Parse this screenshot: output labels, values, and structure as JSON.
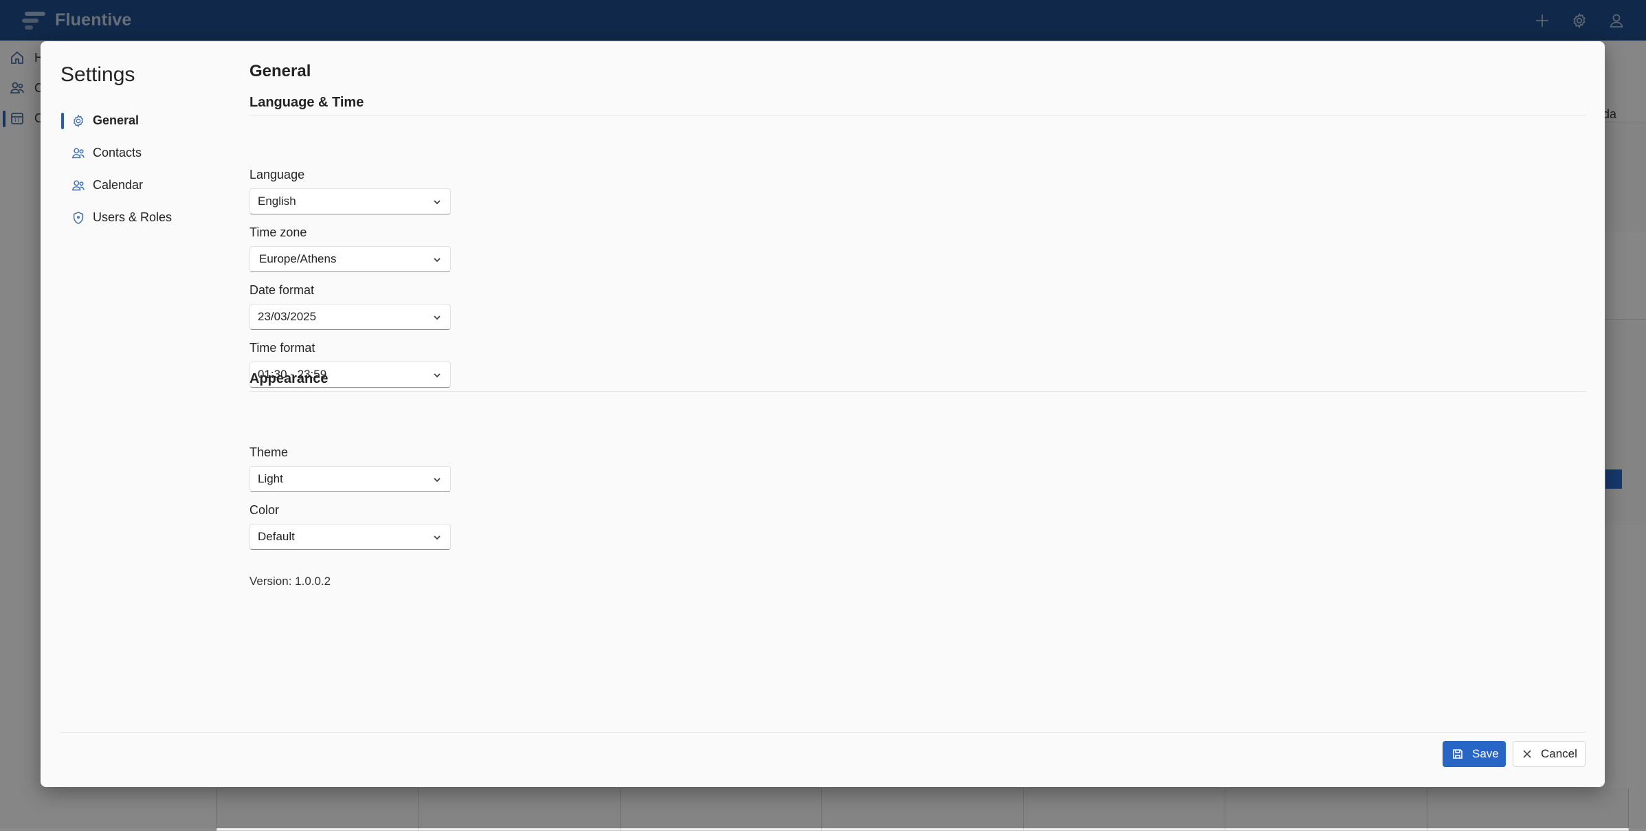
{
  "app": {
    "name": "Fluentive"
  },
  "topbar": {
    "icons": [
      "add-icon",
      "settings-icon",
      "user-icon"
    ]
  },
  "background": {
    "nav_items": [
      {
        "label": "H",
        "icon": "home-icon"
      },
      {
        "label": "C",
        "icon": "contacts-icon"
      },
      {
        "label": "C",
        "icon": "calendar-icon"
      }
    ],
    "right_label": "nda"
  },
  "dialog": {
    "title": "Settings",
    "nav": [
      {
        "label": "General",
        "icon": "gear-icon",
        "active": true
      },
      {
        "label": "Contacts",
        "icon": "people-icon",
        "active": false
      },
      {
        "label": "Calendar",
        "icon": "people-icon",
        "active": false
      },
      {
        "label": "Users & Roles",
        "icon": "shield-icon",
        "active": false
      }
    ],
    "page_title": "General",
    "sections": {
      "language_time": {
        "title": "Language & Time",
        "language": {
          "label": "Language",
          "value": "English"
        },
        "time_zone": {
          "label": "Time zone",
          "value": "Europe/Athens"
        },
        "date_format": {
          "label": "Date format",
          "value": "23/03/2025"
        },
        "time_format": {
          "label": "Time format",
          "value": "01:30 - 23:59"
        }
      },
      "appearance": {
        "title": "Appearance",
        "theme": {
          "label": "Theme",
          "value": "Light"
        },
        "color": {
          "label": "Color",
          "value": "Default"
        }
      }
    },
    "version": "Version: 1.0.0.2",
    "buttons": {
      "save": "Save",
      "cancel": "Cancel"
    }
  },
  "colors": {
    "topbar": "#1e4a86",
    "accent": "#2766c4",
    "dialog_bg": "#fafafa"
  }
}
